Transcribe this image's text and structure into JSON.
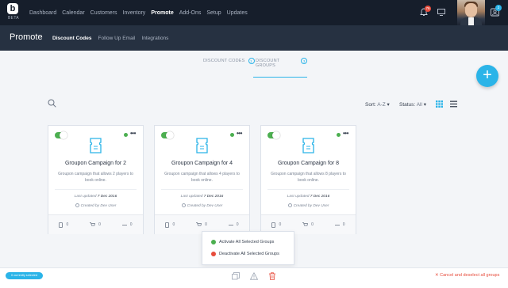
{
  "topnav": {
    "logo_text": "b",
    "beta": "BETA",
    "links": [
      "Dashboard",
      "Calendar",
      "Customers",
      "Inventory",
      "Promote",
      "Add-Ons",
      "Setup",
      "Updates"
    ],
    "active": "Promote",
    "bell_badge": "76",
    "profile_badge": "2"
  },
  "subnav": {
    "title": "Promote",
    "links": [
      "Discount Codes",
      "Follow Up Email",
      "Integrations"
    ],
    "active": "Discount Codes"
  },
  "tabs": [
    {
      "label": "DISCOUNT CODES",
      "count": "1",
      "active": false
    },
    {
      "label": "DISCOUNT GROUPS",
      "count": "3",
      "active": true
    }
  ],
  "fab_label": "+",
  "toolbar": {
    "sort_label": "Sort:",
    "sort_value": "A-Z",
    "status_label": "Status:",
    "status_value": "All"
  },
  "cards": [
    {
      "name": "Groupon Campaign for 2",
      "description": "Groupon campaign that allows 2 players to book online.",
      "updated_label": "Last updated",
      "updated_date": "7 Dec 2016",
      "created": "Created by Dev User",
      "stats": [
        "0",
        "0",
        "0"
      ]
    },
    {
      "name": "Groupon Campaign for 4",
      "description": "Groupon campaign that allows 4 players to book online.",
      "updated_label": "Last updated",
      "updated_date": "7 Dec 2016",
      "created": "Created by Dev User",
      "stats": [
        "0",
        "0",
        "0"
      ]
    },
    {
      "name": "Groupon Campaign for 8",
      "description": "Groupon campaign that allows 8 players to book online.",
      "updated_label": "Last updated",
      "updated_date": "7 Dec 2016",
      "created": "Created by Dev User",
      "stats": [
        "0",
        "0",
        "0"
      ]
    }
  ],
  "popup": {
    "activate": "Activate All Selected Groups",
    "deactivate": "Deactivate All Selected Groups"
  },
  "bottombar": {
    "selected": "0 currently selected",
    "cancel": "Cancel and deselect all groups"
  },
  "colors": {
    "accent": "#2bb4e8",
    "active_green": "#4caf50",
    "danger_red": "#e74c3c",
    "nav_bg": "#161e2b",
    "subnav_bg": "#263141"
  }
}
